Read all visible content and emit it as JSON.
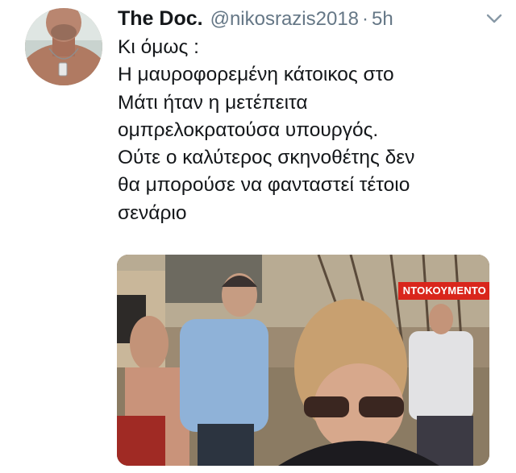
{
  "tweet": {
    "display_name": "The Doc.",
    "handle": "@nikosrazis2018",
    "separator": "·",
    "time": "5h",
    "body_lines": [
      "Κι όμως :",
      "Η μαυροφορεμένη κάτοικος στο",
      "Μάτι ήταν η μετέπειτα",
      "ομπρελοκρατούσα υπουργός.",
      "Ούτε ο καλύτερος σκηνοθέτης δεν",
      "θα μπορούσε να φανταστεί τέτοιο",
      "σενάριο"
    ],
    "media": {
      "badge_text": "ΝΤΟΚΟΥΜΕΝΤΟ"
    }
  },
  "icons": {
    "more": "chevron-down-icon"
  },
  "colors": {
    "text": "#14171a",
    "secondary": "#657786",
    "badge": "#d9261c"
  }
}
